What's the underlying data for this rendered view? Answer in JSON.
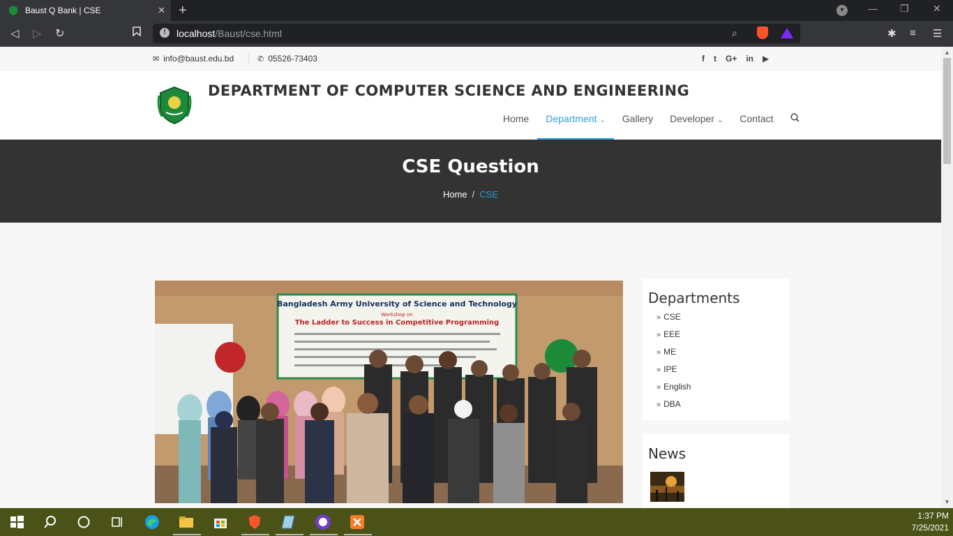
{
  "browser": {
    "tab_title": "Baust Q Bank | CSE",
    "url_host": "localhost",
    "url_path": "/Baust/cse.html"
  },
  "topbar": {
    "email": "info@baust.edu.bd",
    "phone": "05526-73403",
    "social": [
      "f",
      "t",
      "G+",
      "in",
      "yt"
    ]
  },
  "header": {
    "title": "DEPARTMENT OF COMPUTER SCIENCE AND ENGINEERING",
    "menu": {
      "home": "Home",
      "department": "Department",
      "gallery": "Gallery",
      "developer": "Developer",
      "contact": "Contact"
    }
  },
  "hero": {
    "title": "CSE Question",
    "crumb_home": "Home",
    "crumb_sep": "/",
    "crumb_current": "CSE"
  },
  "photo": {
    "banner_line1": "Bangladesh Army University of Science and Technology",
    "banner_line2": "Workshop on",
    "banner_line3": "The Ladder to Success in Competitive Programming"
  },
  "sidebar": {
    "departments_title": "Departments",
    "departments": [
      "CSE",
      "EEE",
      "ME",
      "IPE",
      "English",
      "DBA"
    ],
    "news_title": "News"
  },
  "taskbar": {
    "time": "1:37 PM",
    "date": "7/25/2021"
  },
  "colors": {
    "accent": "#2ea0da",
    "hero_bg": "#333333",
    "taskbar_bg": "#4a5217"
  }
}
